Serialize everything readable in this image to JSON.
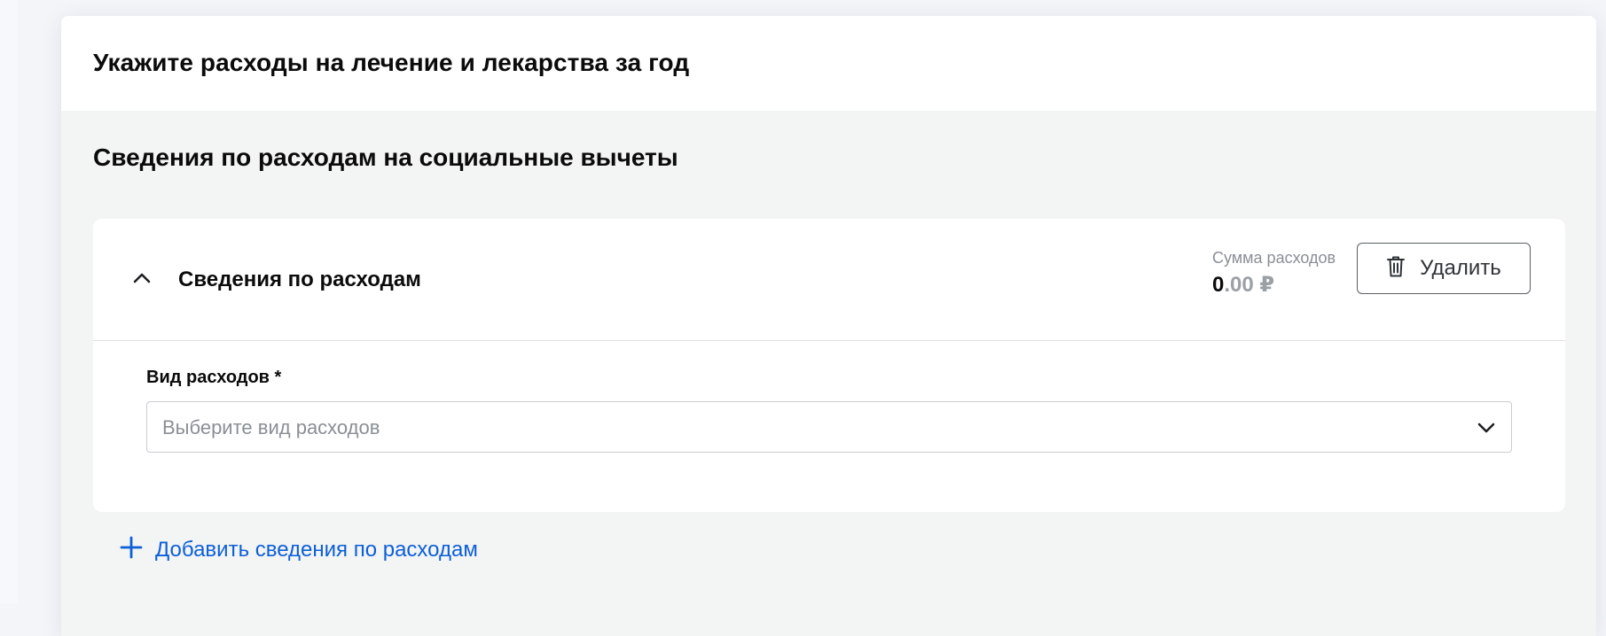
{
  "page": {
    "title": "Укажите расходы на лечение и лекарства за год",
    "section_title": "Сведения по расходам на социальные вычеты"
  },
  "expense": {
    "title": "Сведения по расходам",
    "sum_label": "Сумма расходов",
    "sum_integer": "0",
    "sum_fraction": ".00 ₽",
    "delete_label": "Удалить",
    "field_label": "Вид расходов *",
    "select_placeholder": "Выберите вид расходов"
  },
  "add_link": "Добавить сведения по расходам",
  "icons": {
    "collapse": "chevron-up-icon",
    "delete": "trash-icon",
    "select": "chevron-down-icon",
    "add": "plus-icon"
  },
  "colors": {
    "link": "#0d5fd8",
    "muted": "#8a8f96"
  }
}
